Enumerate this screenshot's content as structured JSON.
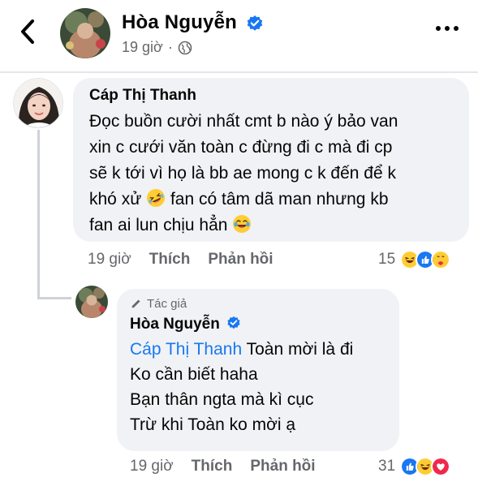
{
  "header": {
    "author_name": "Hòa Nguyễn",
    "time": "19 giờ",
    "separator": "·",
    "privacy_icon": "globe-icon",
    "back_icon": "chevron-left-icon",
    "more_icon": "more-horizontal-icon"
  },
  "comment": {
    "author_name": "Cáp Thị Thanh",
    "text_lines": [
      "Đọc buồn cười nhất cmt b nào ý bảo van",
      "xin c cưới văn toàn c đừng đi c mà đi cp",
      "sẽ k tới vì họ là bb ae mong c k đến để k",
      "khó xử",
      "fan có tâm dã man nhưng kb",
      "fan ai lun chịu hẳn"
    ],
    "emoji_1": "rolling-on-floor-laughing-emoji",
    "emoji_2": "tears-of-joy-emoji",
    "time": "19 giờ",
    "like_label": "Thích",
    "reply_label": "Phản hồi",
    "reaction_count": "15",
    "reactions": [
      "haha",
      "like",
      "care"
    ]
  },
  "reply": {
    "author_badge": "Tác giả",
    "author_name": "Hòa Nguyễn",
    "mention": "Cáp Thị Thanh",
    "text_lines": [
      "Toàn mời là đi",
      "Ko cần biết haha",
      "Bạn thân ngta mà kì cục",
      "Trừ khi Toàn ko mời ạ"
    ],
    "time": "19 giờ",
    "like_label": "Thích",
    "reply_label": "Phản hồi",
    "reaction_count": "31",
    "reactions": [
      "like",
      "haha",
      "love"
    ]
  },
  "colors": {
    "verified": "#1877f2",
    "bubble": "#f0f2f5",
    "secondary_text": "#65676b",
    "mention": "#1877f2"
  }
}
